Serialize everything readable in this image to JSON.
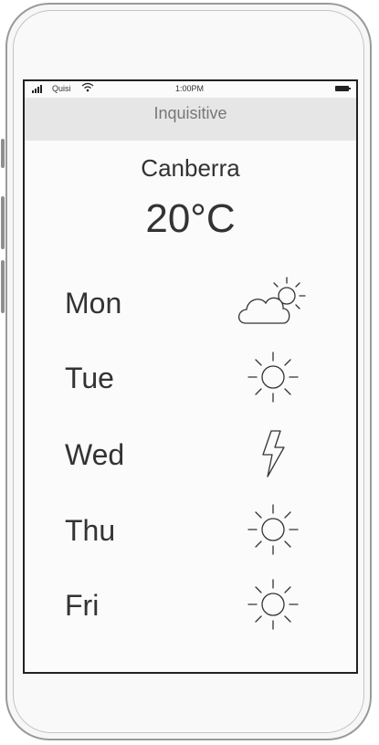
{
  "status_bar": {
    "carrier": "Quisi",
    "time": "1:00PM"
  },
  "nav": {
    "title": "Inquisitive"
  },
  "weather": {
    "city": "Canberra",
    "temperature": "20°C",
    "forecast": [
      {
        "day": "Mon",
        "icon": "partly-cloudy-icon"
      },
      {
        "day": "Tue",
        "icon": "sun-icon"
      },
      {
        "day": "Wed",
        "icon": "lightning-icon"
      },
      {
        "day": "Thu",
        "icon": "sun-icon"
      },
      {
        "day": "Fri",
        "icon": "sun-icon"
      }
    ]
  }
}
